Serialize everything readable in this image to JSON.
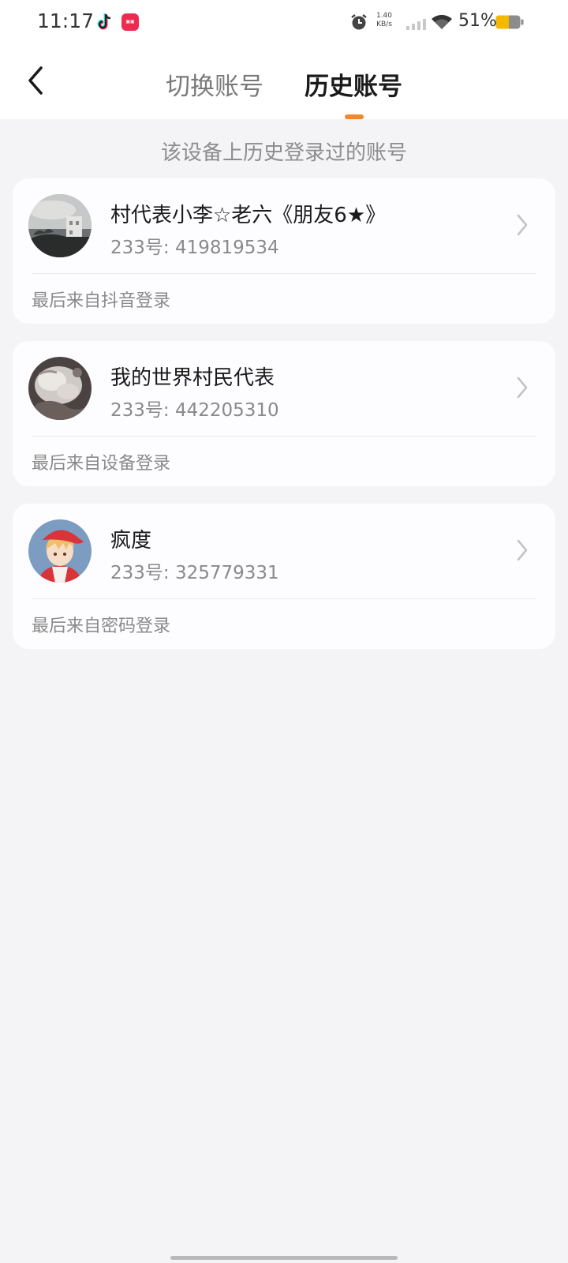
{
  "status_bar": {
    "time": "11:17",
    "net_speed_value": "1.40",
    "net_speed_unit": "KB/s",
    "battery": "51%",
    "icons": [
      "tiktok-icon",
      "app-badge-icon",
      "alarm-icon",
      "signal-icon",
      "wifi-icon",
      "battery-icon"
    ]
  },
  "header": {
    "tabs": [
      {
        "label": "切换账号",
        "active": false
      },
      {
        "label": "历史账号",
        "active": true
      }
    ],
    "accent_color": "#f5862a"
  },
  "hint": "该设备上历史登录过的账号",
  "accounts": [
    {
      "name": "村代表小李☆老六《朋友6★》",
      "id_text": "233号: 419819534",
      "source": "最后来自抖音登录",
      "avatar": "photo-sky-building"
    },
    {
      "name": "我的世界村民代表",
      "id_text": "233号: 442205310",
      "source": "最后来自设备登录",
      "avatar": "photo-white-cat"
    },
    {
      "name": "疯度",
      "id_text": "233号: 325779331",
      "source": "最后来自密码登录",
      "avatar": "anime-boy-red-cap"
    }
  ]
}
